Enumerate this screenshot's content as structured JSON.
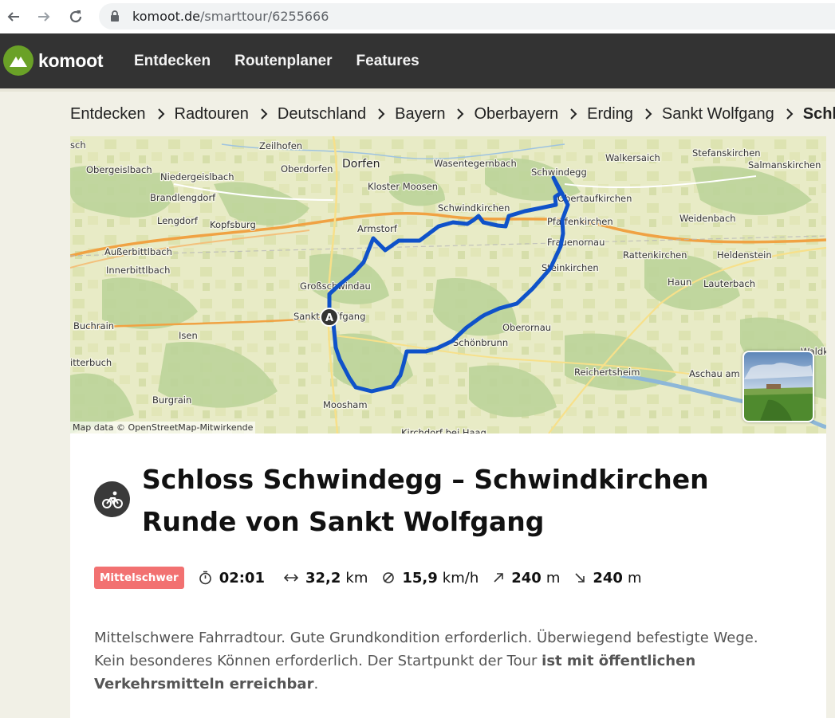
{
  "browser": {
    "url_domain": "komoot.de",
    "url_path": "/smarttour/6255666"
  },
  "header": {
    "logo_text": "komoot",
    "nav": [
      "Entdecken",
      "Routenplaner",
      "Features"
    ]
  },
  "breadcrumb": [
    "Entdecken",
    "Radtouren",
    "Deutschland",
    "Bayern",
    "Oberbayern",
    "Erding",
    "Sankt Wolfgang",
    "Schloss Schwindegg"
  ],
  "map": {
    "places": [
      "Dorfen",
      "Zeilhofen",
      "Obergeislbach",
      "Niedergeislbach",
      "Oberdorfen",
      "Brandlengdorf",
      "Lengdorf",
      "Kopfsburg",
      "Kloster Moosen",
      "Wasentegernbach",
      "Walkersaich",
      "Stefanskirchen",
      "Salmanskirchen",
      "Schwindegg",
      "Obertaufkirchen",
      "Schwindkirchen",
      "Pfaffenkirchen",
      "Weidenbach",
      "Armstorf",
      "Frauenornau",
      "Außerbittlbach",
      "Innerbittlbach",
      "Rattenkirchen",
      "Heldenstein",
      "Großschwindau",
      "Steinkirchen",
      "Haun",
      "Lauterbach",
      "Sankt Wolfgang",
      "Buchrain",
      "Isen",
      "Oberornau",
      "Schönbrunn",
      "Reichertsheim",
      "Aschau am Inn",
      "Waldkraiburg",
      "itterbuch",
      "Burgrain",
      "Moosham",
      "Kirchdorf bei Haag",
      "sch"
    ],
    "start_marker": "A",
    "attribution": "Map data © OpenStreetMap-Mitwirkende"
  },
  "tour": {
    "sport_icon": "bike-icon",
    "title": "Schloss Schwindegg – Schwindkirchen Runde von Sankt Wolfgang",
    "difficulty": "Mittelschwer",
    "duration": "02:01",
    "distance_value": "32,2",
    "distance_unit": "km",
    "speed_value": "15,9",
    "speed_unit": "km/h",
    "ascent_value": "240",
    "ascent_unit": "m",
    "descent_value": "240",
    "descent_unit": "m",
    "description_part1": "Mittelschwere Fahrradtour. Gute Grundkondition erforderlich. Überwiegend befestigte Wege. Kein besonderes Können erforderlich. Der Startpunkt der Tour ",
    "description_bold": "ist mit öffentlichen Verkehrsmitteln erreichbar",
    "description_end": "."
  },
  "colors": {
    "header_bg": "#333333",
    "logo_green": "#6aa127",
    "route": "#0f52c9",
    "difficulty_badge": "#f27171"
  }
}
